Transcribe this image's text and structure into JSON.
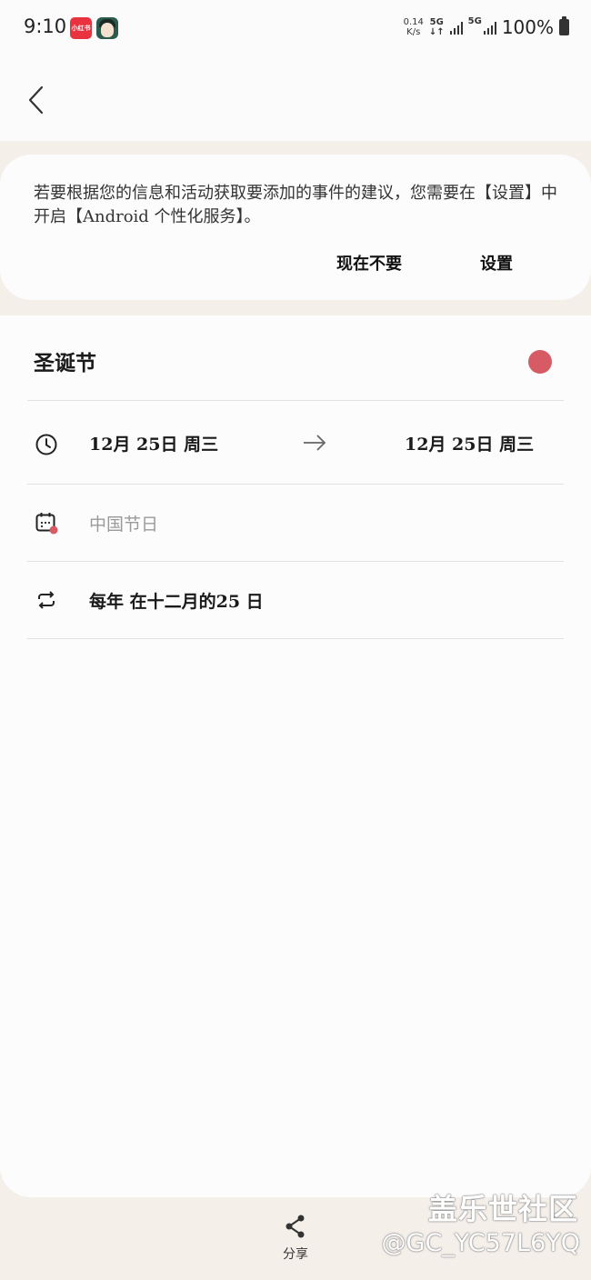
{
  "status_bar": {
    "time": "9:10",
    "app_icon_1_text": "小红书",
    "net_speed_value": "0.14",
    "net_speed_unit": "K/s",
    "net_type_1": "5G",
    "net_type_2": "5G",
    "battery": "100%"
  },
  "suggestion": {
    "message": "若要根据您的信息和活动获取要添加的事件的建议，您需要在【设置】中开启【Android 个性化服务】。",
    "later_label": "现在不要",
    "settings_label": "设置"
  },
  "event": {
    "title": "圣诞节",
    "color": "#d75b65",
    "start_date": "12月 25日 周三",
    "end_date": "12月 25日 周三",
    "calendar": "中国节日",
    "repeat": "每年 在十二月的25 日"
  },
  "bottom": {
    "share_label": "分享"
  },
  "watermark": {
    "line1": "盖乐世社区",
    "line2": "@GC_YC57L6YQ"
  }
}
